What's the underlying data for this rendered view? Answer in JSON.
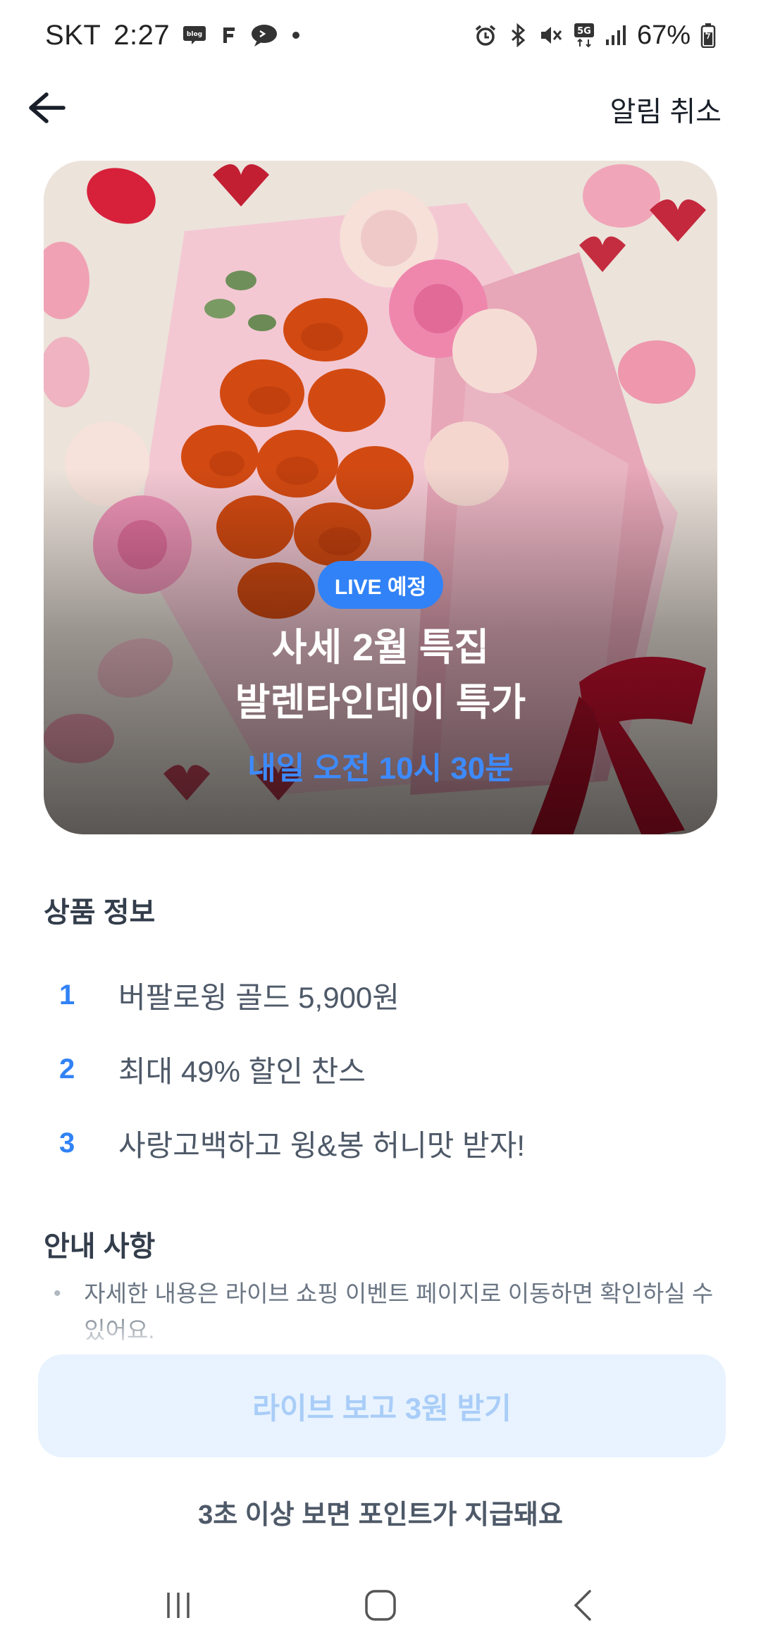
{
  "status_bar": {
    "carrier": "SKT",
    "time": "2:27",
    "notification_icons": [
      "blog-icon",
      "f-icon",
      "chat-bubble-icon",
      "dot-icon"
    ],
    "system_icons": [
      "alarm-icon",
      "bluetooth-icon",
      "mute-icon",
      "5g-icon",
      "signal-icon"
    ],
    "battery": "67%"
  },
  "app_bar": {
    "back_icon": "arrow-left-icon",
    "cancel_label": "알림 취소"
  },
  "hero": {
    "badge": "LIVE 예정",
    "title_line1": "사세 2월 특집",
    "title_line2": "발렌타인데이 특가",
    "schedule": "내일 오전 10시 30분"
  },
  "product_info": {
    "title": "상품 정보",
    "items": [
      {
        "num": "1",
        "text": "버팔로윙 골드 5,900원"
      },
      {
        "num": "2",
        "text": "최대 49% 할인 찬스"
      },
      {
        "num": "3",
        "text": "사랑고백하고 윙&봉 허니맛 받자!"
      }
    ]
  },
  "notice": {
    "title": "안내 사항",
    "items": [
      {
        "bullet": "•",
        "text": "자세한 내용은 라이브 쇼핑 이벤트 페이지로 이동하면 확인하실 수 있어요."
      }
    ]
  },
  "cta": {
    "label": "라이브 보고 3원 받기",
    "sub": "3초 이상 보면 포인트가 지급돼요"
  },
  "colors": {
    "accent": "#3182f6",
    "cta_bg": "#e8f3ff",
    "cta_text": "#a9cdf8"
  }
}
